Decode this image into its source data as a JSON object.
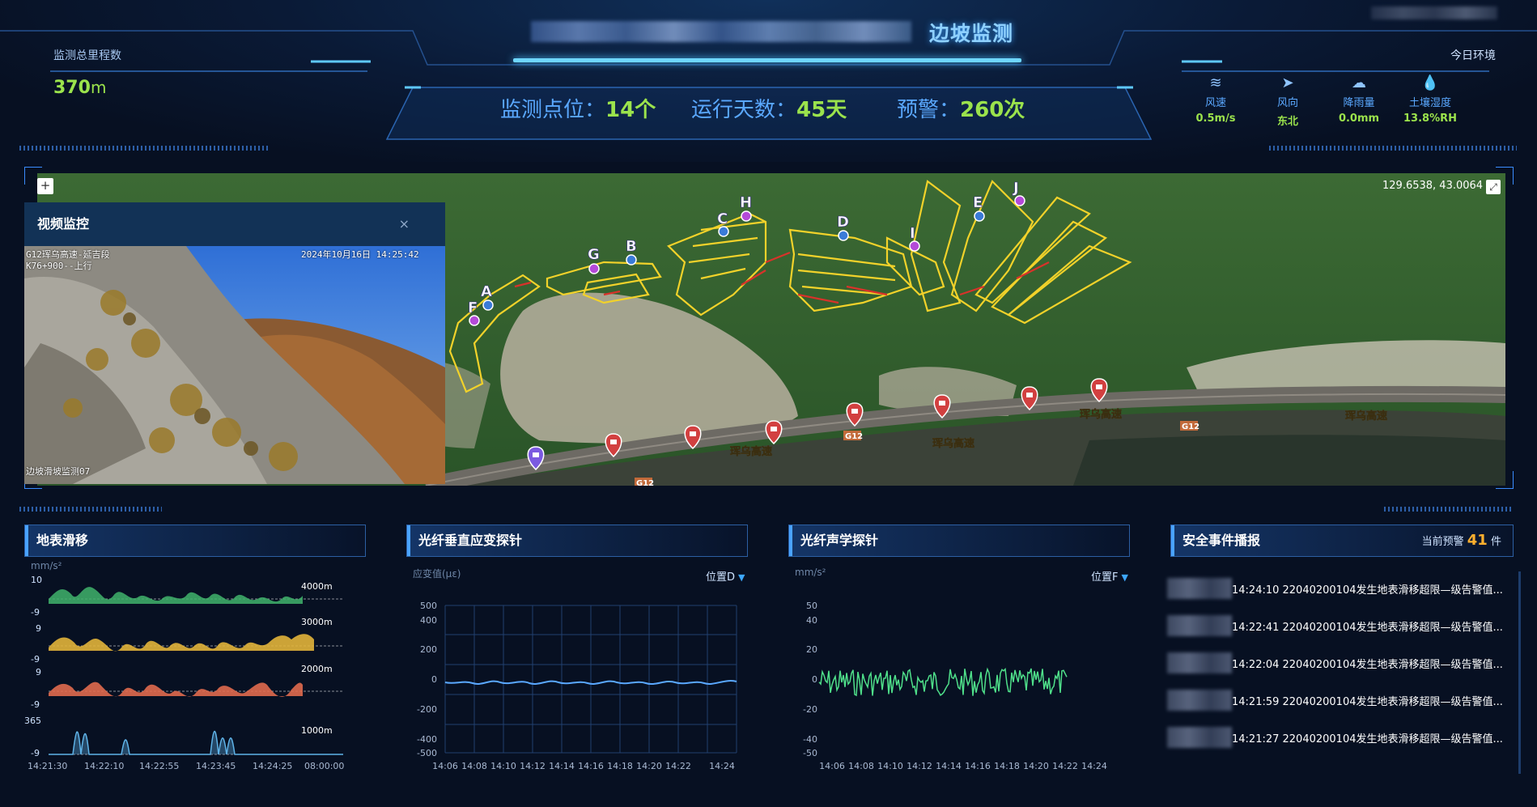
{
  "header": {
    "title": "边坡监测",
    "mileage": {
      "label": "监测总里程数",
      "value": "370",
      "unit": "m"
    },
    "stats": [
      {
        "label": "监测点位：",
        "value": "14个"
      },
      {
        "label": "运行天数：",
        "value": "45天"
      },
      {
        "label": "预警：",
        "value": "260次"
      }
    ],
    "environment": {
      "title": "今日环境",
      "items": [
        {
          "label": "风速",
          "value": "0.5m/s",
          "icon": "wind-icon"
        },
        {
          "label": "风向",
          "value": "东北",
          "icon": "navigation-arrow-icon"
        },
        {
          "label": "降雨量",
          "value": "0.0mm",
          "icon": "rain-cloud-icon"
        },
        {
          "label": "土壤湿度",
          "value": "13.8%RH",
          "icon": "water-drop-icon"
        }
      ]
    }
  },
  "map": {
    "coordinates": "129.6538, 43.0064",
    "zoom_in": "+",
    "expand_icon": "⤢",
    "point_labels": [
      "A",
      "B",
      "C",
      "D",
      "E",
      "F",
      "G",
      "H",
      "I",
      "J"
    ],
    "road_labels": [
      "珲乌高速",
      "珲乌高速",
      "珲乌高速",
      "珲乌高速"
    ],
    "road_badges": [
      "G12",
      "G12",
      "G12"
    ],
    "video": {
      "title": "视频监控",
      "close": "×",
      "overlay_top_left_1": "G12珲乌高速-延吉段",
      "overlay_top_left_2": "K76+900--上行",
      "overlay_timestamp": "2024年10月16日  14:25:42",
      "overlay_bottom": "边坡滑坡监测07"
    }
  },
  "panels": {
    "surface": {
      "title": "地表滑移",
      "unit": "mm/s²",
      "rows": [
        {
          "top": "10",
          "bottom": "-9",
          "depth": "4000m",
          "color": "#3fb36b"
        },
        {
          "top": "9",
          "bottom": "-9",
          "depth": "3000m",
          "color": "#e2b43a"
        },
        {
          "top": "9",
          "bottom": "-9",
          "depth": "2000m",
          "color": "#e06a4e"
        },
        {
          "top": "365",
          "bottom": "-9",
          "depth": "1000m",
          "color": "#5fb3e8"
        }
      ],
      "x_ticks": [
        "14:21:30",
        "14:22:10",
        "14:22:55",
        "14:23:45",
        "14:24:25",
        "08:00:00"
      ]
    },
    "strain": {
      "title": "光纤垂直应变探针",
      "ylabel": "应变值(με)",
      "selector": "位置D",
      "y_ticks": [
        "500",
        "400",
        "200",
        "0",
        "-200",
        "-400",
        "-500"
      ],
      "x_ticks": [
        "14:06",
        "14:08",
        "14:10",
        "14:12",
        "14:14",
        "14:16",
        "14:18",
        "14:20",
        "14:22",
        "14:24"
      ]
    },
    "acoustic": {
      "title": "光纤声学探针",
      "unit": "mm/s²",
      "selector": "位置F",
      "y_ticks": [
        "50",
        "40",
        "20",
        "0",
        "-20",
        "-40",
        "-50"
      ],
      "x_ticks": [
        "14:06",
        "14:08",
        "14:10",
        "14:12",
        "14:14",
        "14:16",
        "14:18",
        "14:20",
        "14:22",
        "14:24"
      ]
    },
    "events": {
      "title": "安全事件播报",
      "count_label": "当前预警",
      "count": "41",
      "count_unit": "件",
      "items": [
        "14:24:10 22040200104发生地表滑移超限—级告警值...",
        "14:22:41 22040200104发生地表滑移超限—级告警值...",
        "14:22:04 22040200104发生地表滑移超限—级告警值...",
        "14:21:59 22040200104发生地表滑移超限—级告警值...",
        "14:21:27 22040200104发生地表滑移超限—级告警值..."
      ]
    }
  }
}
